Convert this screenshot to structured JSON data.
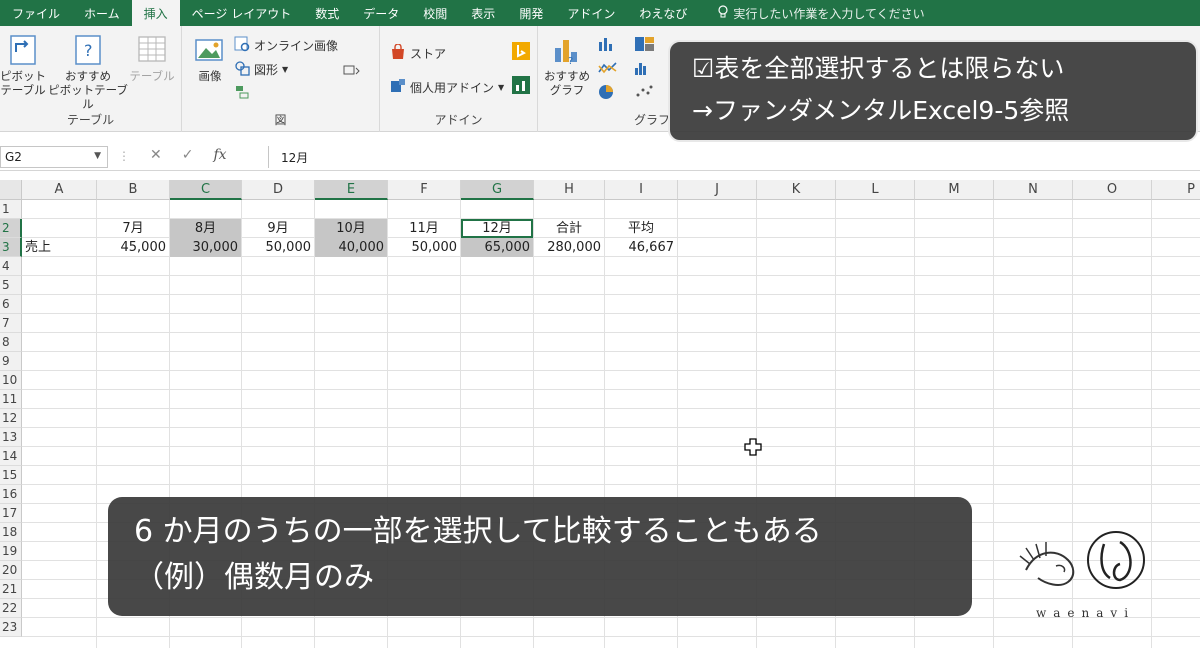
{
  "tabs": [
    "ファイル",
    "ホーム",
    "挿入",
    "ページ レイアウト",
    "数式",
    "データ",
    "校閲",
    "表示",
    "開発",
    "アドイン",
    "わえなび"
  ],
  "active_tab_index": 2,
  "tell_me": "実行したい作業を入力してください",
  "ribbon": {
    "pivot_label_1": "ピボット",
    "pivot_label_2": "テーブル",
    "rec_pivot_1": "おすすめ",
    "rec_pivot_2": "ピボットテーブル",
    "table_label": "テーブル",
    "group_table": "テーブル",
    "image_label": "画像",
    "online_image": "オンライン画像",
    "shapes": "図形",
    "group_figure": "図",
    "store": "ストア",
    "personal_addin": "個人用アドイン",
    "group_addin": "アドイン",
    "rec_chart_1": "おすすめ",
    "rec_chart_2": "グラフ",
    "group_chart": "グラフ"
  },
  "formula_bar": {
    "name_box": "G2",
    "cancel": "✕",
    "enter": "✓",
    "fx": "fx",
    "value": "12月"
  },
  "columns": [
    "A",
    "B",
    "C",
    "D",
    "E",
    "F",
    "G",
    "H",
    "I",
    "J",
    "K",
    "L",
    "M",
    "N",
    "O",
    "P"
  ],
  "selected_columns": [
    "C",
    "E",
    "G"
  ],
  "rows": [
    "1",
    "2",
    "3",
    "4",
    "5",
    "6",
    "7",
    "8",
    "9",
    "10",
    "11",
    "12",
    "13",
    "14",
    "15",
    "16",
    "17",
    "18",
    "19",
    "20",
    "21",
    "22",
    "23"
  ],
  "selected_rows": [
    "2",
    "3"
  ],
  "cells": {
    "B2": "7月",
    "C2": "8月",
    "D2": "9月",
    "E2": "10月",
    "F2": "11月",
    "G2": "12月",
    "H2": "合計",
    "I2": "平均",
    "A3": "売上",
    "B3": "45,000",
    "C3": "30,000",
    "D3": "50,000",
    "E3": "40,000",
    "F3": "50,000",
    "G3": "65,000",
    "H3": "280,000",
    "I3": "46,667"
  },
  "active_cell": "G2",
  "overlay_top": {
    "line1": "☑表を全部選択するとは限らない",
    "line2": "→ファンダメンタルExcel9-5参照"
  },
  "overlay_bottom": {
    "line1": "6 か月のうちの一部を選択して比較することもある",
    "line2": "（例）偶数月のみ"
  },
  "logo_text": "waenavi",
  "colors": {
    "excel_green": "#217346",
    "selection_gray": "#c6c6c6",
    "overlay": "#3a3a3a"
  }
}
